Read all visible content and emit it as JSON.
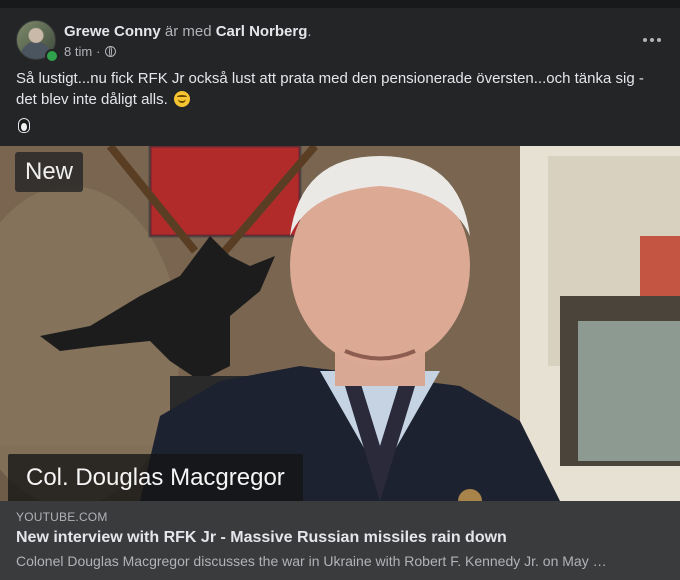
{
  "post": {
    "author": "Grewe Conny",
    "with_text": "är med",
    "tagged": "Carl Norberg",
    "time": "8 tim",
    "text": "Så lustigt...nu fick RFK Jr också lust att prata med den pensionerade översten...och tänka sig - det blev inte dåligt alls."
  },
  "video": {
    "badge": "New",
    "lower_third": "Col. Douglas Macgregor"
  },
  "link": {
    "domain": "YOUTUBE.COM",
    "title": "New interview with RFK Jr - Massive Russian missiles rain down",
    "description": "Colonel Douglas Macgregor discusses the war in Ukraine with Robert F. Kennedy Jr. on May …"
  },
  "icons": {
    "more": "more-options-icon",
    "privacy": "globe-icon",
    "emoji": "smiling-face-icon",
    "extra": "penguin-icon"
  },
  "colors": {
    "background": "#18191a",
    "card": "#242526",
    "link_box": "#3a3b3c",
    "online": "#31a24c"
  }
}
